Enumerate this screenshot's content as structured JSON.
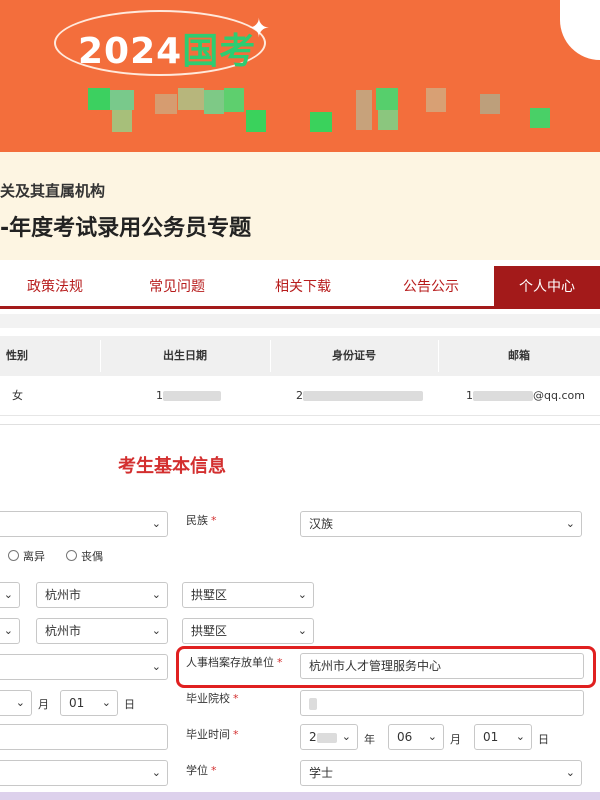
{
  "banner": {
    "logo_year": "2024",
    "logo_word": "国考",
    "colors": {
      "background": "#f36e3c",
      "accent_green": "#2ecc71"
    }
  },
  "title": {
    "line1": "关及其直属机构",
    "line2": "-年度考试录用公务员专题"
  },
  "nav": {
    "items": [
      {
        "label": "政策法规",
        "active": false
      },
      {
        "label": "常见问题",
        "active": false
      },
      {
        "label": "相关下载",
        "active": false
      },
      {
        "label": "公告公示",
        "active": false
      },
      {
        "label": "个人中心",
        "active": true
      }
    ],
    "active_color": "#a31a1a"
  },
  "info_table": {
    "headers": [
      "性别",
      "出生日期",
      "身份证号",
      "邮箱"
    ],
    "row": {
      "gender": "女",
      "birth_prefix": "1",
      "id_prefix": "2",
      "email_prefix": "1",
      "email_suffix": "@qq.com"
    }
  },
  "form": {
    "section_title": "考生基本信息",
    "ethnicity_label": "民族",
    "ethnicity_value": "汉族",
    "marital_options": [
      "离异",
      "丧偶"
    ],
    "row1_city": "杭州市",
    "row1_district": "拱墅区",
    "row2_city": "杭州市",
    "row2_district": "拱墅区",
    "archive_label": "人事档案存放单位",
    "archive_value": "杭州市人才管理服务中心",
    "month_unit": "月",
    "day_unit": "日",
    "year_unit": "年",
    "month_value_left": "01",
    "school_label": "毕业院校",
    "grad_time_label": "毕业时间",
    "grad_year_prefix": "2",
    "grad_month": "06",
    "grad_day": "01",
    "degree_label": "学位",
    "degree_value": "学士",
    "required_mark": "*",
    "arrow_glyph": "⌄"
  }
}
